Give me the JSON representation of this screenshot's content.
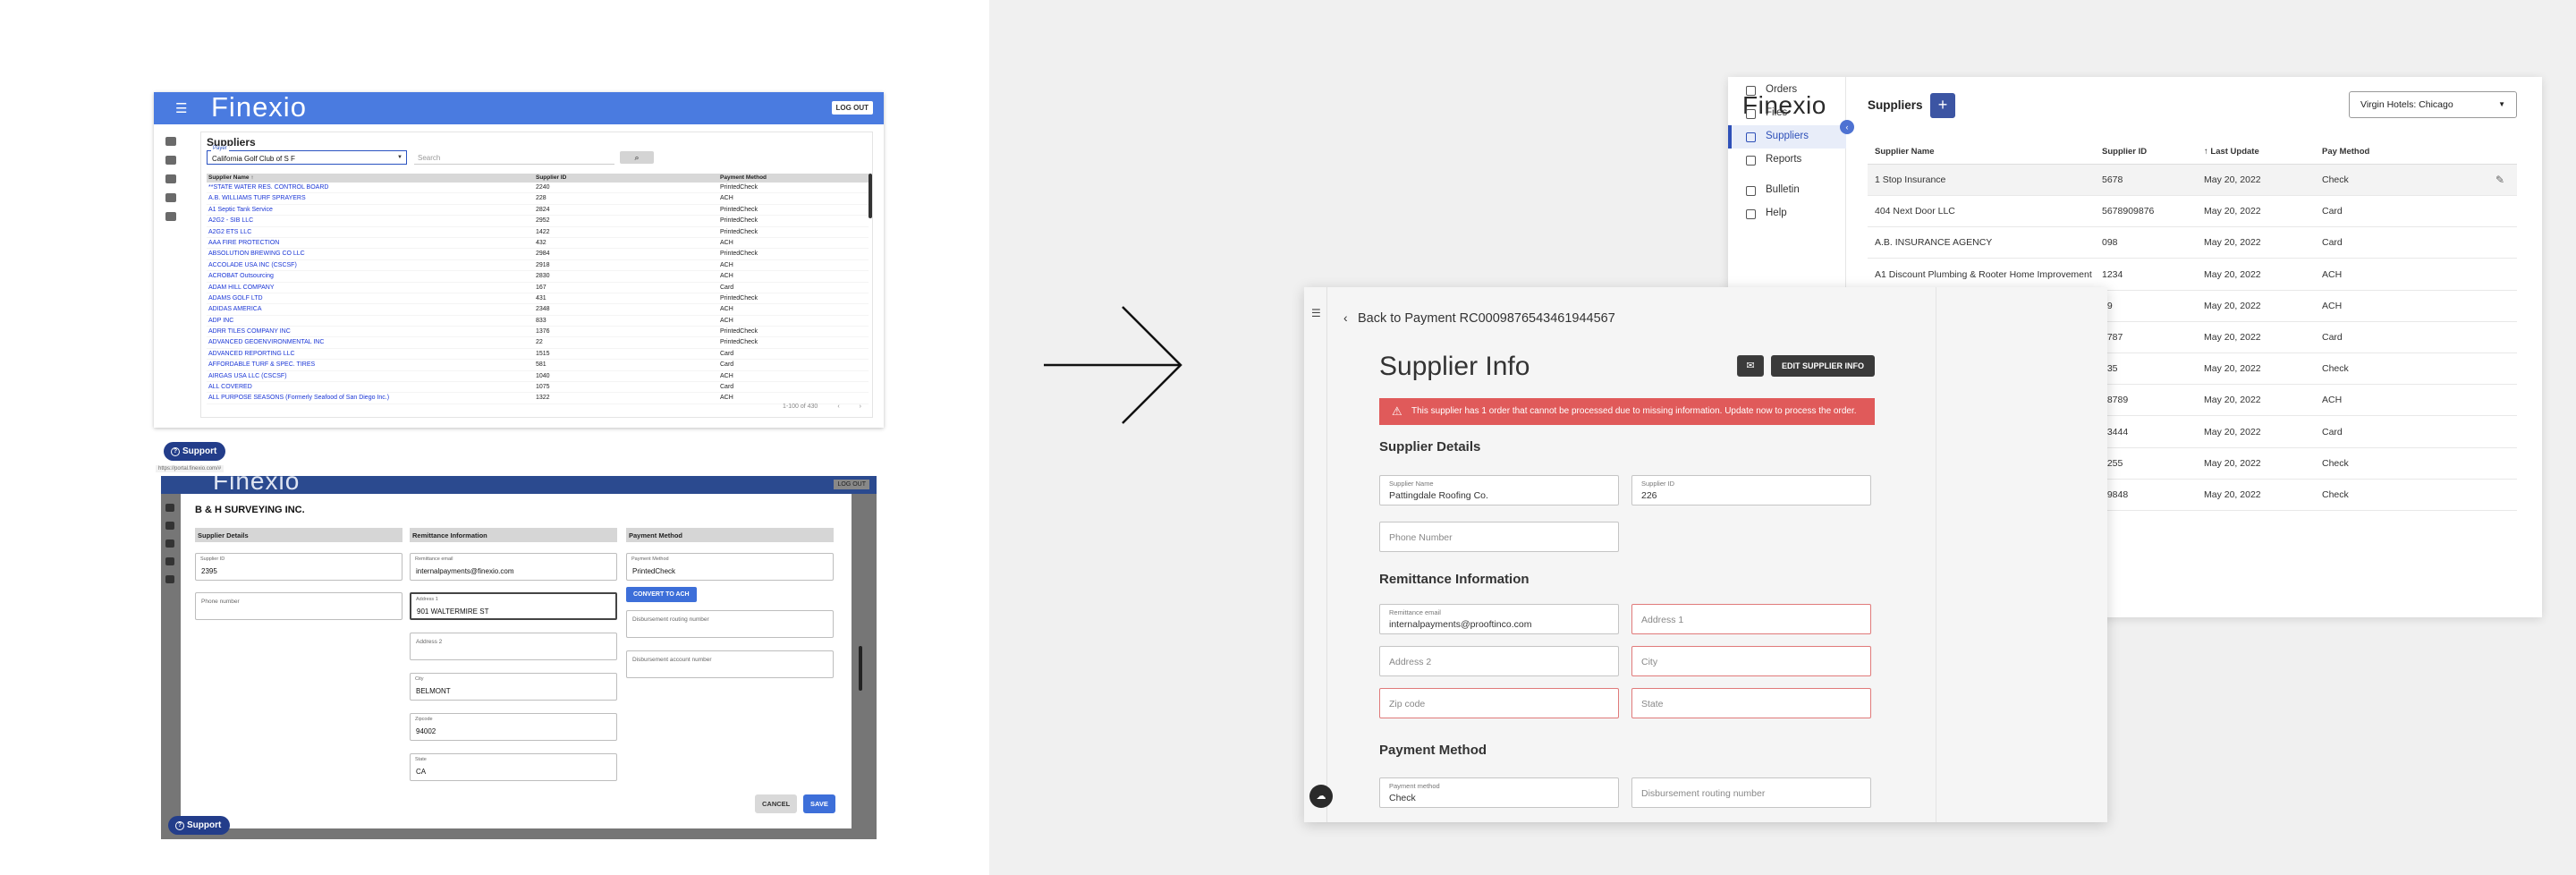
{
  "old_list": {
    "logo": "Finexio",
    "logout": "LOG OUT",
    "title": "Suppliers",
    "payer_label": "Payer",
    "payer_value": "California Golf Club of S F",
    "search_placeholder": "Search",
    "search_icon": "search-icon",
    "columns": [
      "Supplier Name ↑",
      "Supplier ID",
      "Payment Method"
    ],
    "rows": [
      [
        "**STATE WATER RES. CONTROL BOARD",
        "2240",
        "PrintedCheck"
      ],
      [
        "A.B. WILLIAMS TURF SPRAYERS",
        "228",
        "ACH"
      ],
      [
        "A1 Septic Tank Service",
        "2824",
        "PrintedCheck"
      ],
      [
        "A2G2 - SIB LLC",
        "2952",
        "PrintedCheck"
      ],
      [
        "A2G2 ETS LLC",
        "1422",
        "PrintedCheck"
      ],
      [
        "AAA FIRE PROTECTION",
        "432",
        "ACH"
      ],
      [
        "ABSOLUTION BREWING CO LLC",
        "2984",
        "PrintedCheck"
      ],
      [
        "ACCOLADE USA INC (CSCSF)",
        "2918",
        "ACH"
      ],
      [
        "ACROBAT Outsourcing",
        "2830",
        "ACH"
      ],
      [
        "ADAM HILL COMPANY",
        "167",
        "Card"
      ],
      [
        "ADAMS GOLF LTD",
        "431",
        "PrintedCheck"
      ],
      [
        "ADIDAS AMERICA",
        "2348",
        "ACH"
      ],
      [
        "ADP INC",
        "833",
        "ACH"
      ],
      [
        "ADRR TILES COMPANY INC",
        "1376",
        "PrintedCheck"
      ],
      [
        "ADVANCED GEOENVIRONMENTAL INC",
        "22",
        "PrintedCheck"
      ],
      [
        "ADVANCED REPORTING LLC",
        "1515",
        "Card"
      ],
      [
        "AFFORDABLE TURF & SPEC. TIRES",
        "581",
        "Card"
      ],
      [
        "AIRGAS USA LLC (CSCSF)",
        "1040",
        "ACH"
      ],
      [
        "ALL COVERED",
        "1075",
        "Card"
      ],
      [
        "ALL PURPOSE SEASONS (Formerly Seafood of San Diego Inc.)",
        "1322",
        "ACH"
      ]
    ],
    "pagination": [
      "1-100 of 430",
      "‹",
      "›"
    ]
  },
  "support_label": "Support",
  "status_url": "https://portal.finexio.com/#",
  "old_modal": {
    "logo": "Finexio",
    "logout": "LOG OUT",
    "title": "B & H SURVEYING INC.",
    "sections": [
      "Supplier Details",
      "Remittance Information",
      "Payment Method"
    ],
    "supplier_id_label": "Supplier ID",
    "supplier_id": "2395",
    "phone_placeholder": "Phone number",
    "remit_email_label": "Remittance email",
    "remit_email": "internalpayments@finexio.com",
    "address1_label": "Address 1",
    "address1": "901 WALTERMIRE ST",
    "address2_placeholder": "Address 2",
    "city_label": "City",
    "city": "BELMONT",
    "zip_label": "Zipcode",
    "zip": "94002",
    "state_label": "State",
    "state": "CA",
    "pay_method_label": "Payment Method",
    "pay_method": "PrintedCheck",
    "convert_btn": "CONVERT TO ACH",
    "routing_placeholder": "Disbursement routing number",
    "account_placeholder": "Disbursement account number",
    "cancel": "CANCEL",
    "save": "SAVE"
  },
  "new_list": {
    "logo": "Finexio",
    "nav": [
      {
        "label": "Orders",
        "icon": "home-icon"
      },
      {
        "label": "Files",
        "icon": "file-icon"
      },
      {
        "label": "Suppliers",
        "icon": "building-icon"
      },
      {
        "label": "Reports",
        "icon": "chart-icon"
      },
      {
        "label": "Bulletin",
        "icon": "bell-icon"
      },
      {
        "label": "Help",
        "icon": "help-icon"
      }
    ],
    "title": "Suppliers",
    "add": "+",
    "client": "Virgin Hotels: Chicago",
    "columns": [
      "Supplier Name",
      "Supplier ID",
      "↑ Last Update",
      "Pay Method"
    ],
    "rows": [
      [
        "1 Stop Insurance",
        "5678",
        "May 20, 2022",
        "Check"
      ],
      [
        "404 Next Door LLC",
        "5678909876",
        "May 20, 2022",
        "Card"
      ],
      [
        "A.B. INSURANCE AGENCY",
        "098",
        "May 20, 2022",
        "Card"
      ],
      [
        "A1 Discount Plumbing & Rooter Home Improvement",
        "1234",
        "May 20, 2022",
        "ACH"
      ],
      [
        "",
        "89",
        "May 20, 2022",
        "ACH"
      ],
      [
        "",
        "6787",
        "May 20, 2022",
        "Card"
      ],
      [
        "",
        "435",
        "May 20, 2022",
        "Check"
      ],
      [
        "",
        "98789",
        "May 20, 2022",
        "ACH"
      ],
      [
        "",
        "23444",
        "May 20, 2022",
        "Card"
      ],
      [
        "",
        "3255",
        "May 20, 2022",
        "Check"
      ],
      [
        "",
        "19848",
        "May 20, 2022",
        "Check"
      ]
    ]
  },
  "detail": {
    "back": "Back to Payment RC0009876543461944567",
    "title": "Supplier Info",
    "edit_btn": "EDIT SUPPLIER INFO",
    "alert": "This supplier has 1 order that cannot be processed due to missing information. Update now to process the order.",
    "sec_details": "Supplier Details",
    "name_label": "Supplier Name",
    "name": "Pattingdale Roofing Co.",
    "id_label": "Supplier ID",
    "id": "226",
    "phone_ph": "Phone Number",
    "sec_remit": "Remittance Information",
    "email_label": "Remittance email",
    "email": "internalpayments@prooftinco.com",
    "address1_ph": "Address 1",
    "address2_ph": "Address 2",
    "city_ph": "City",
    "zip_ph": "Zip code",
    "state_ph": "State",
    "sec_payment": "Payment Method",
    "pm_label": "Payment method",
    "pm": "Check",
    "routing_ph": "Disbursement routing number"
  },
  "colors": {
    "old_header": "#4a7be0",
    "old_link": "#1a36d6",
    "accent": "#2e50b8",
    "alert": "#e05a5a"
  }
}
